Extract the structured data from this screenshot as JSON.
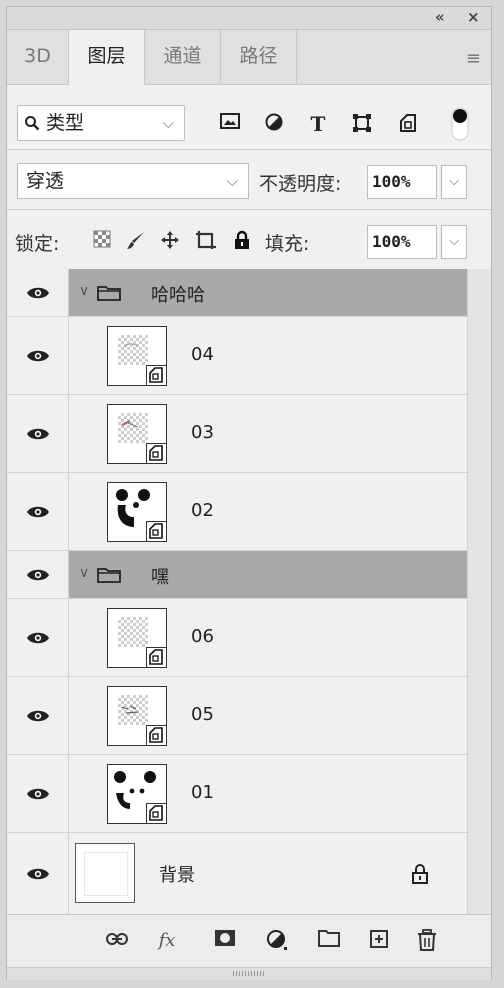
{
  "window": {
    "collapse_glyph": "«",
    "close_glyph": "×"
  },
  "tabs": [
    {
      "label": "3D",
      "active": false
    },
    {
      "label": "图层",
      "active": true
    },
    {
      "label": "通道",
      "active": false
    },
    {
      "label": "路径",
      "active": false
    }
  ],
  "filter": {
    "kind_label": "类型",
    "icons": [
      "image-filter-icon",
      "adjustment-filter-icon",
      "type-filter-icon",
      "shape-filter-icon",
      "smart-object-filter-icon",
      "filter-toggle-icon"
    ]
  },
  "blend": {
    "mode": "穿透",
    "opacity_label": "不透明度:",
    "opacity_value": "100%"
  },
  "lock": {
    "label": "锁定:",
    "fill_label": "填充:",
    "fill_value": "100%",
    "icons": [
      "lock-transparent-pixels-icon",
      "lock-image-pixels-icon",
      "lock-position-icon",
      "lock-artboard-icon",
      "lock-all-icon"
    ]
  },
  "layers": [
    {
      "type": "group",
      "name": "哈哈哈"
    },
    {
      "type": "smart",
      "name": "04"
    },
    {
      "type": "smart",
      "name": "03"
    },
    {
      "type": "smart",
      "name": "02"
    },
    {
      "type": "group",
      "name": "嘿"
    },
    {
      "type": "smart",
      "name": "06"
    },
    {
      "type": "smart",
      "name": "05"
    },
    {
      "type": "smart",
      "name": "01"
    },
    {
      "type": "background",
      "name": "背景"
    }
  ],
  "footer": {
    "icons": [
      "link-layers-icon",
      "fx-icon",
      "add-mask-icon",
      "new-adjustment-icon",
      "new-group-icon",
      "new-layer-icon",
      "delete-layer-icon"
    ],
    "fx_text": "fx"
  }
}
